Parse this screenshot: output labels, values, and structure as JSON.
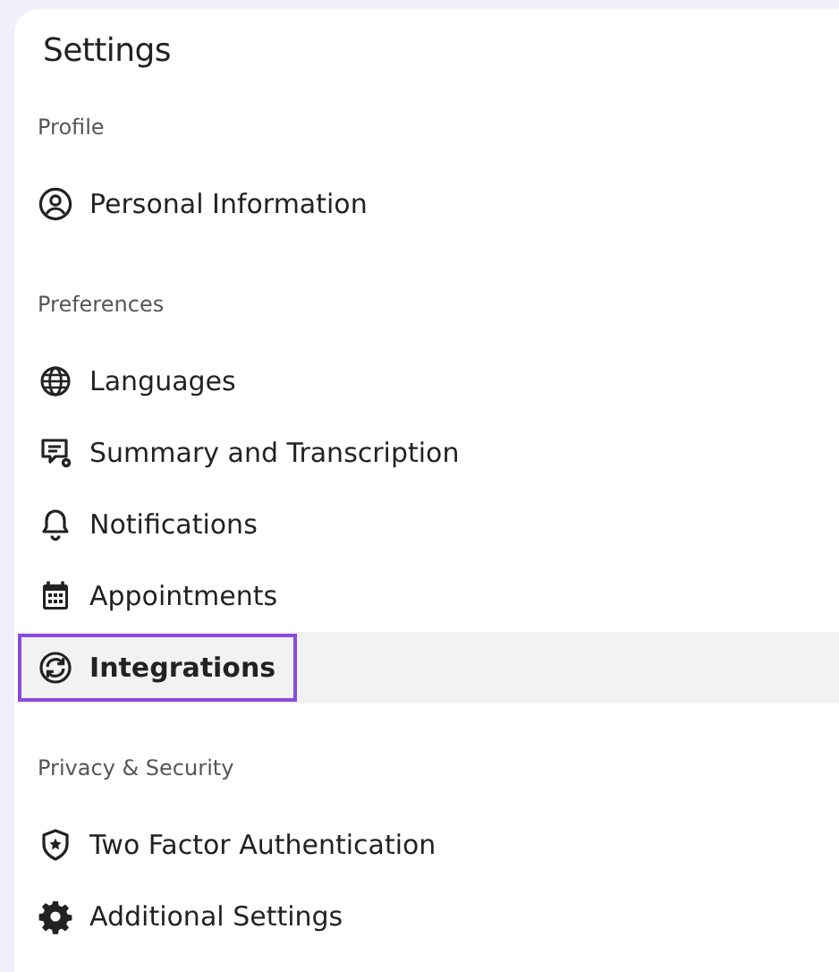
{
  "title": "Settings",
  "sections": [
    {
      "label": "Profile",
      "items": [
        {
          "label": "Personal Information",
          "kind": "person",
          "selected": false
        }
      ]
    },
    {
      "label": "Preferences",
      "items": [
        {
          "label": "Languages",
          "kind": "globe",
          "selected": false
        },
        {
          "label": "Summary and Transcription",
          "kind": "chat-gear",
          "selected": false
        },
        {
          "label": "Notifications",
          "kind": "bell",
          "selected": false
        },
        {
          "label": "Appointments",
          "kind": "calendar",
          "selected": false
        },
        {
          "label": "Integrations",
          "kind": "sync",
          "selected": true
        }
      ]
    },
    {
      "label": "Privacy & Security",
      "items": [
        {
          "label": "Two Factor Authentication",
          "kind": "shield",
          "selected": false
        },
        {
          "label": "Additional Settings",
          "kind": "gear",
          "selected": false
        }
      ]
    }
  ]
}
